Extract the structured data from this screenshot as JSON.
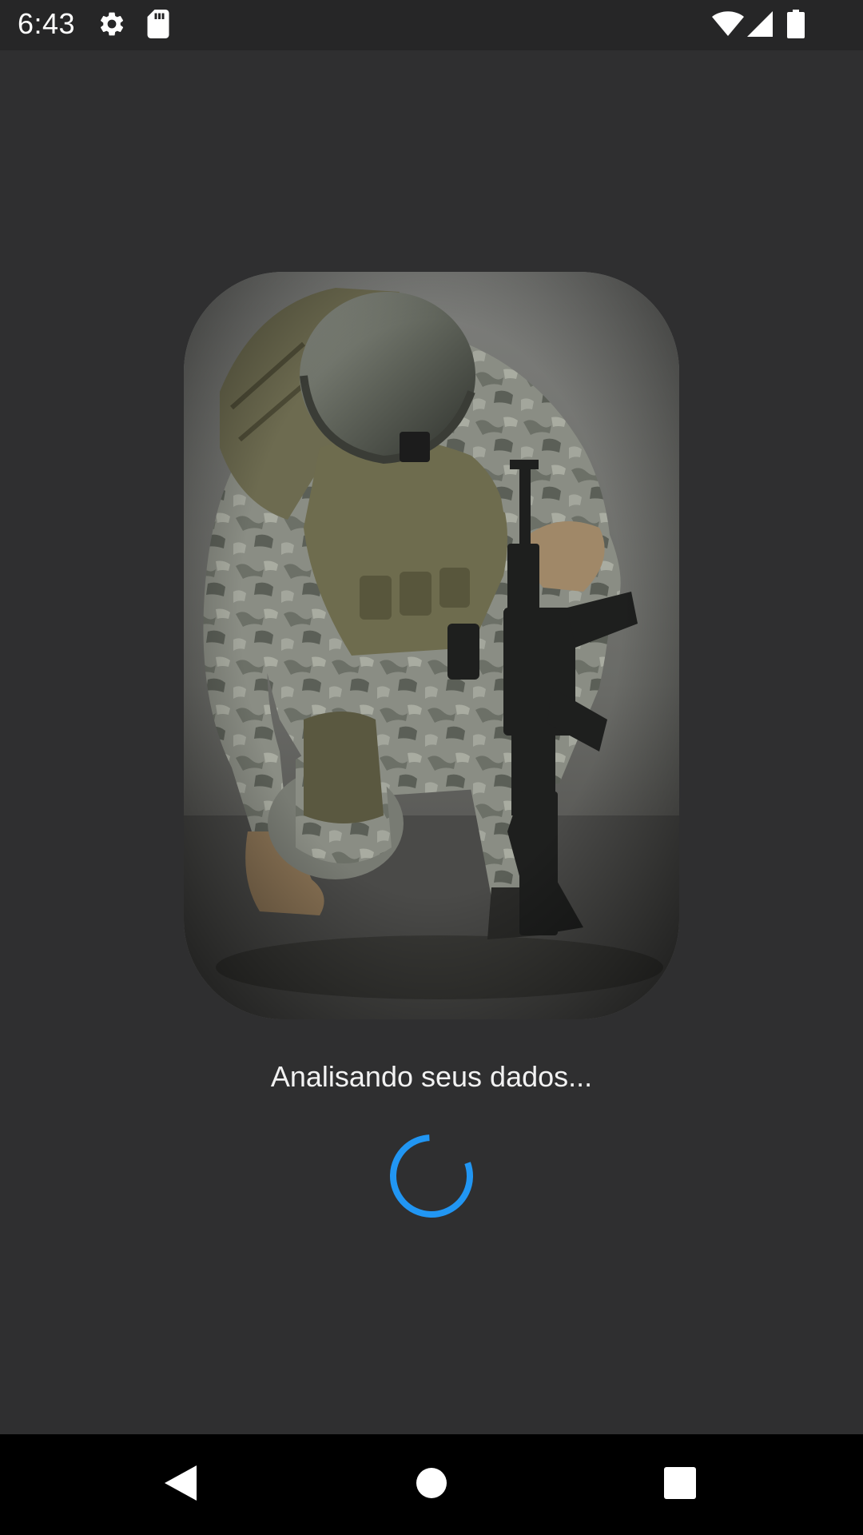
{
  "status_bar": {
    "time": "6:43",
    "icons_left": [
      "gear-icon",
      "sd-card-icon"
    ],
    "icons_right": [
      "wifi-icon",
      "cell-signal-icon",
      "battery-icon"
    ]
  },
  "main": {
    "hero_image": "soldier-kneeling-with-rifle",
    "loading_message": "Analisando seus dados...",
    "spinner_color": "#2196f3"
  },
  "nav_bar": {
    "buttons": [
      "back-icon",
      "home-icon",
      "recents-icon"
    ]
  }
}
